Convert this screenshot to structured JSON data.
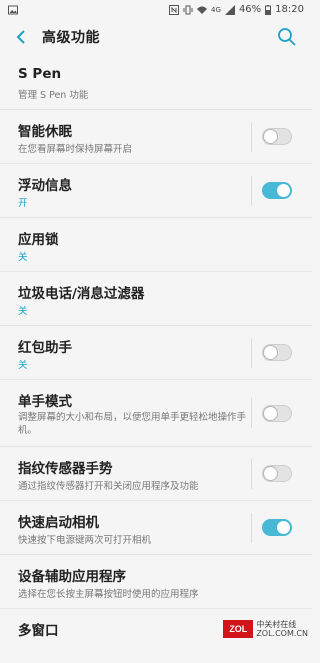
{
  "status": {
    "battery": "46%",
    "time": "18:20",
    "network": "4G"
  },
  "appbar": {
    "title": "高级功能"
  },
  "rows": [
    {
      "title": "S Pen",
      "subtitle": "管理 S Pen 功能",
      "accent": false
    },
    {
      "title": "智能休眠",
      "subtitle": "在您看屏幕时保持屏幕开启",
      "accent": false,
      "toggle": false
    },
    {
      "title": "浮动信息",
      "subtitle": "开",
      "accent": true,
      "toggle": true
    },
    {
      "title": "应用锁",
      "subtitle": "关",
      "accent": true
    },
    {
      "title": "垃圾电话/消息过滤器",
      "subtitle": "关",
      "accent": true
    },
    {
      "title": "红包助手",
      "subtitle": "关",
      "accent": true,
      "toggle": false
    },
    {
      "title": "单手模式",
      "subtitle": "调整屏幕的大小和布局，以便您用单手更轻松地操作手机。",
      "accent": false,
      "toggle": false
    },
    {
      "title": "指纹传感器手势",
      "subtitle": "通过指纹传感器打开和关闭应用程序及功能",
      "accent": false,
      "toggle": false
    },
    {
      "title": "快速启动相机",
      "subtitle": "快速按下电源键两次可打开相机",
      "accent": false,
      "toggle": true
    },
    {
      "title": "设备辅助应用程序",
      "subtitle": "选择在您长按主屏幕按钮时使用的应用程序",
      "accent": false
    },
    {
      "title": "多窗口",
      "subtitle": "",
      "accent": false
    }
  ],
  "watermark": {
    "logo": "ZOL",
    "line1": "中关村在线",
    "line2": "ZOL.COM.CN"
  }
}
